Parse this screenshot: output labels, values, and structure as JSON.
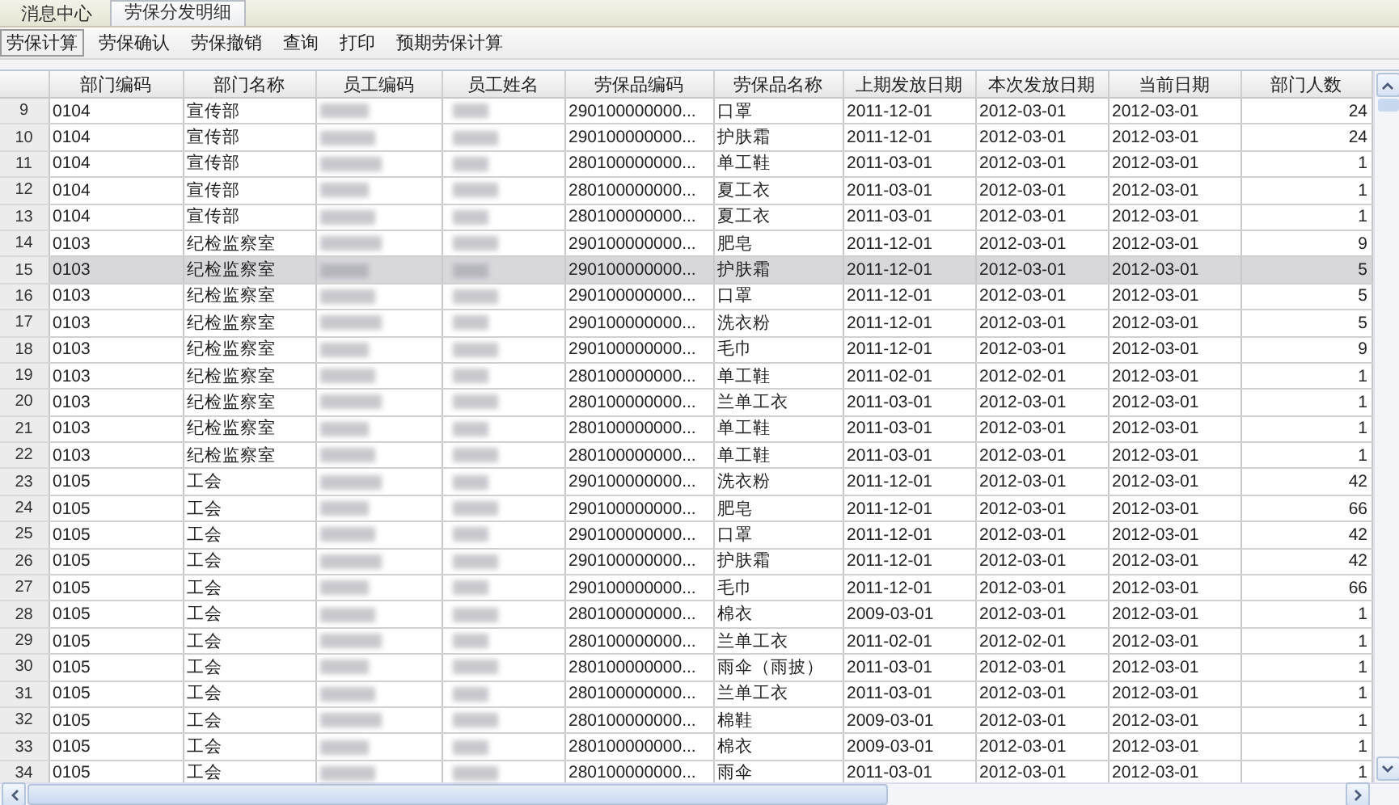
{
  "tabs": [
    {
      "label": "消息中心",
      "selected": false
    },
    {
      "label": "劳保分发明细",
      "selected": true
    }
  ],
  "toolbar": [
    {
      "label": "劳保计算",
      "selected": true
    },
    {
      "label": "劳保确认",
      "selected": false
    },
    {
      "label": "劳保撤销",
      "selected": false
    },
    {
      "label": "查询",
      "selected": false
    },
    {
      "label": "打印",
      "selected": false
    },
    {
      "label": "预期劳保计算",
      "selected": false
    }
  ],
  "table": {
    "columns": [
      "部门编码",
      "部门名称",
      "员工编码",
      "员工姓名",
      "劳保品编码",
      "劳保品名称",
      "上期发放日期",
      "本次发放日期",
      "当前日期",
      "部门人数"
    ],
    "rows": [
      {
        "n": "9",
        "dept_code": "0104",
        "dept": "宣传部",
        "item_code": "290100000000...",
        "item": "口罩",
        "last": "2011-12-01",
        "this": "2012-03-01",
        "today": "2012-03-01",
        "count": "24",
        "selected": false
      },
      {
        "n": "10",
        "dept_code": "0104",
        "dept": "宣传部",
        "item_code": "290100000000...",
        "item": "护肤霜",
        "last": "2011-12-01",
        "this": "2012-03-01",
        "today": "2012-03-01",
        "count": "24",
        "selected": false
      },
      {
        "n": "11",
        "dept_code": "0104",
        "dept": "宣传部",
        "item_code": "280100000000...",
        "item": "单工鞋",
        "last": "2011-03-01",
        "this": "2012-03-01",
        "today": "2012-03-01",
        "count": "1",
        "selected": false
      },
      {
        "n": "12",
        "dept_code": "0104",
        "dept": "宣传部",
        "item_code": "280100000000...",
        "item": "夏工衣",
        "last": "2011-03-01",
        "this": "2012-03-01",
        "today": "2012-03-01",
        "count": "1",
        "selected": false
      },
      {
        "n": "13",
        "dept_code": "0104",
        "dept": "宣传部",
        "item_code": "280100000000...",
        "item": "夏工衣",
        "last": "2011-03-01",
        "this": "2012-03-01",
        "today": "2012-03-01",
        "count": "1",
        "selected": false
      },
      {
        "n": "14",
        "dept_code": "0103",
        "dept": "纪检监察室",
        "item_code": "290100000000...",
        "item": "肥皂",
        "last": "2011-12-01",
        "this": "2012-03-01",
        "today": "2012-03-01",
        "count": "9",
        "selected": false
      },
      {
        "n": "15",
        "dept_code": "0103",
        "dept": "纪检监察室",
        "item_code": "290100000000...",
        "item": "护肤霜",
        "last": "2011-12-01",
        "this": "2012-03-01",
        "today": "2012-03-01",
        "count": "5",
        "selected": true
      },
      {
        "n": "16",
        "dept_code": "0103",
        "dept": "纪检监察室",
        "item_code": "290100000000...",
        "item": "口罩",
        "last": "2011-12-01",
        "this": "2012-03-01",
        "today": "2012-03-01",
        "count": "5",
        "selected": false
      },
      {
        "n": "17",
        "dept_code": "0103",
        "dept": "纪检监察室",
        "item_code": "290100000000...",
        "item": "洗衣粉",
        "last": "2011-12-01",
        "this": "2012-03-01",
        "today": "2012-03-01",
        "count": "5",
        "selected": false
      },
      {
        "n": "18",
        "dept_code": "0103",
        "dept": "纪检监察室",
        "item_code": "290100000000...",
        "item": "毛巾",
        "last": "2011-12-01",
        "this": "2012-03-01",
        "today": "2012-03-01",
        "count": "9",
        "selected": false
      },
      {
        "n": "19",
        "dept_code": "0103",
        "dept": "纪检监察室",
        "item_code": "280100000000...",
        "item": "单工鞋",
        "last": "2011-02-01",
        "this": "2012-02-01",
        "today": "2012-03-01",
        "count": "1",
        "selected": false
      },
      {
        "n": "20",
        "dept_code": "0103",
        "dept": "纪检监察室",
        "item_code": "280100000000...",
        "item": "兰单工衣",
        "last": "2011-03-01",
        "this": "2012-03-01",
        "today": "2012-03-01",
        "count": "1",
        "selected": false
      },
      {
        "n": "21",
        "dept_code": "0103",
        "dept": "纪检监察室",
        "item_code": "280100000000...",
        "item": "单工鞋",
        "last": "2011-03-01",
        "this": "2012-03-01",
        "today": "2012-03-01",
        "count": "1",
        "selected": false
      },
      {
        "n": "22",
        "dept_code": "0103",
        "dept": "纪检监察室",
        "item_code": "280100000000...",
        "item": "单工鞋",
        "last": "2011-03-01",
        "this": "2012-03-01",
        "today": "2012-03-01",
        "count": "1",
        "selected": false
      },
      {
        "n": "23",
        "dept_code": "0105",
        "dept": "工会",
        "item_code": "290100000000...",
        "item": "洗衣粉",
        "last": "2011-12-01",
        "this": "2012-03-01",
        "today": "2012-03-01",
        "count": "42",
        "selected": false
      },
      {
        "n": "24",
        "dept_code": "0105",
        "dept": "工会",
        "item_code": "290100000000...",
        "item": "肥皂",
        "last": "2011-12-01",
        "this": "2012-03-01",
        "today": "2012-03-01",
        "count": "66",
        "selected": false
      },
      {
        "n": "25",
        "dept_code": "0105",
        "dept": "工会",
        "item_code": "290100000000...",
        "item": "口罩",
        "last": "2011-12-01",
        "this": "2012-03-01",
        "today": "2012-03-01",
        "count": "42",
        "selected": false
      },
      {
        "n": "26",
        "dept_code": "0105",
        "dept": "工会",
        "item_code": "290100000000...",
        "item": "护肤霜",
        "last": "2011-12-01",
        "this": "2012-03-01",
        "today": "2012-03-01",
        "count": "42",
        "selected": false
      },
      {
        "n": "27",
        "dept_code": "0105",
        "dept": "工会",
        "item_code": "290100000000...",
        "item": "毛巾",
        "last": "2011-12-01",
        "this": "2012-03-01",
        "today": "2012-03-01",
        "count": "66",
        "selected": false
      },
      {
        "n": "28",
        "dept_code": "0105",
        "dept": "工会",
        "item_code": "280100000000...",
        "item": "棉衣",
        "last": "2009-03-01",
        "this": "2012-03-01",
        "today": "2012-03-01",
        "count": "1",
        "selected": false
      },
      {
        "n": "29",
        "dept_code": "0105",
        "dept": "工会",
        "item_code": "280100000000...",
        "item": "兰单工衣",
        "last": "2011-02-01",
        "this": "2012-02-01",
        "today": "2012-03-01",
        "count": "1",
        "selected": false
      },
      {
        "n": "30",
        "dept_code": "0105",
        "dept": "工会",
        "item_code": "280100000000...",
        "item": "雨伞（雨披）",
        "last": "2011-03-01",
        "this": "2012-03-01",
        "today": "2012-03-01",
        "count": "1",
        "selected": false
      },
      {
        "n": "31",
        "dept_code": "0105",
        "dept": "工会",
        "item_code": "280100000000...",
        "item": "兰单工衣",
        "last": "2011-03-01",
        "this": "2012-03-01",
        "today": "2012-03-01",
        "count": "1",
        "selected": false
      },
      {
        "n": "32",
        "dept_code": "0105",
        "dept": "工会",
        "item_code": "280100000000...",
        "item": "棉鞋",
        "last": "2009-03-01",
        "this": "2012-03-01",
        "today": "2012-03-01",
        "count": "1",
        "selected": false
      },
      {
        "n": "33",
        "dept_code": "0105",
        "dept": "工会",
        "item_code": "280100000000...",
        "item": "棉衣",
        "last": "2009-03-01",
        "this": "2012-03-01",
        "today": "2012-03-01",
        "count": "1",
        "selected": false
      },
      {
        "n": "34",
        "dept_code": "0105",
        "dept": "工会",
        "item_code": "280100000000...",
        "item": "雨伞",
        "last": "2011-03-01",
        "this": "2012-03-01",
        "today": "2012-03-01",
        "count": "1",
        "selected": false
      }
    ]
  }
}
